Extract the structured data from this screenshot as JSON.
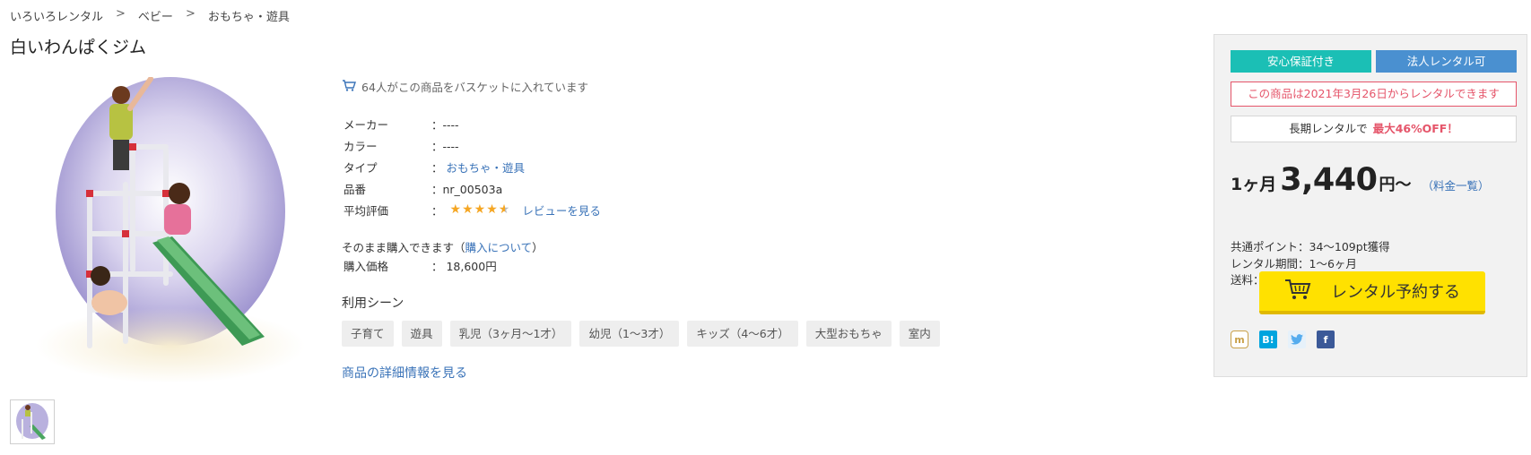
{
  "breadcrumb": {
    "items": [
      "いろいろレンタル",
      "ベビー",
      "おもちゃ・遊具"
    ],
    "separator": ">"
  },
  "product": {
    "title": "白いわんぱくジム"
  },
  "info": {
    "basket_note": "64人がこの商品をバスケットに入れています",
    "specs": [
      {
        "key": "メーカー",
        "value": "：----"
      },
      {
        "key": "カラー",
        "value": "：----"
      },
      {
        "key": "タイプ",
        "value": "：",
        "link": "おもちゃ・遊具"
      },
      {
        "key": "品番",
        "value": "：nr_00503a"
      },
      {
        "key": "平均評価",
        "value": "：",
        "rating": 4.5,
        "review_link": "レビューを見る"
      }
    ],
    "buy_note_prefix": "そのまま購入できます（",
    "buy_note_link": "購入について",
    "buy_note_suffix": "）",
    "buy_price_label": "購入価格",
    "buy_price_value": "：  18,600円",
    "scene_title": "利用シーン",
    "tags": [
      "子育て",
      "遊具",
      "乳児（3ヶ月～1才）",
      "幼児（1～3才）",
      "キッズ（4～6才）",
      "大型おもちゃ",
      "室内"
    ],
    "details_link": "商品の詳細情報を見る"
  },
  "panel": {
    "badge_safe": "安心保証付き",
    "badge_corp": "法人レンタル可",
    "notice": "この商品は2021年3月26日からレンタルできます",
    "longterm_prefix": "長期レンタルで",
    "longterm_highlight": "最大46%OFF！",
    "price_period": "1ヶ月",
    "price_amount": "3,440",
    "price_unit": "円～",
    "fee_link": "（料金一覧）",
    "points": "共通ポイント：34～109pt獲得",
    "rental_period": "レンタル期間：1～6ヶ月",
    "shipping": "送料：2,500円",
    "cta_label": "レンタル予約する",
    "social": [
      "mixi-icon",
      "hatena-bookmark-icon",
      "twitter-icon",
      "facebook-icon"
    ],
    "colors": {
      "safe": "#1bbfb5",
      "corp": "#4a90d0",
      "notice": "#e5556a",
      "cta": "#ffe100"
    }
  }
}
